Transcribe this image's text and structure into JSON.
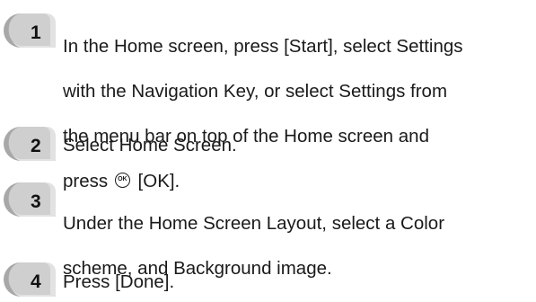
{
  "steps": [
    {
      "number": "1",
      "lines": [
        "In the Home screen, press [Start], select Settings",
        "with the Navigation Key, or select Settings from",
        "the menu bar on top of the Home screen and"
      ],
      "last_line_before_icon": "press",
      "ok_key_icon": "ok-button-icon",
      "ok_key_glyph": "OK",
      "last_line_after_icon": "[OK]."
    },
    {
      "number": "2",
      "text": "Select Home Screen."
    },
    {
      "number": "3",
      "lines": [
        "Under the Home Screen Layout, select a Color",
        "scheme, and Background image."
      ]
    },
    {
      "number": "4",
      "text": "Press [Done]."
    }
  ],
  "colors": {
    "badge_gray": "#b8b8b8",
    "badge_light": "#e0e0e0",
    "text": "#1a1a1a"
  }
}
